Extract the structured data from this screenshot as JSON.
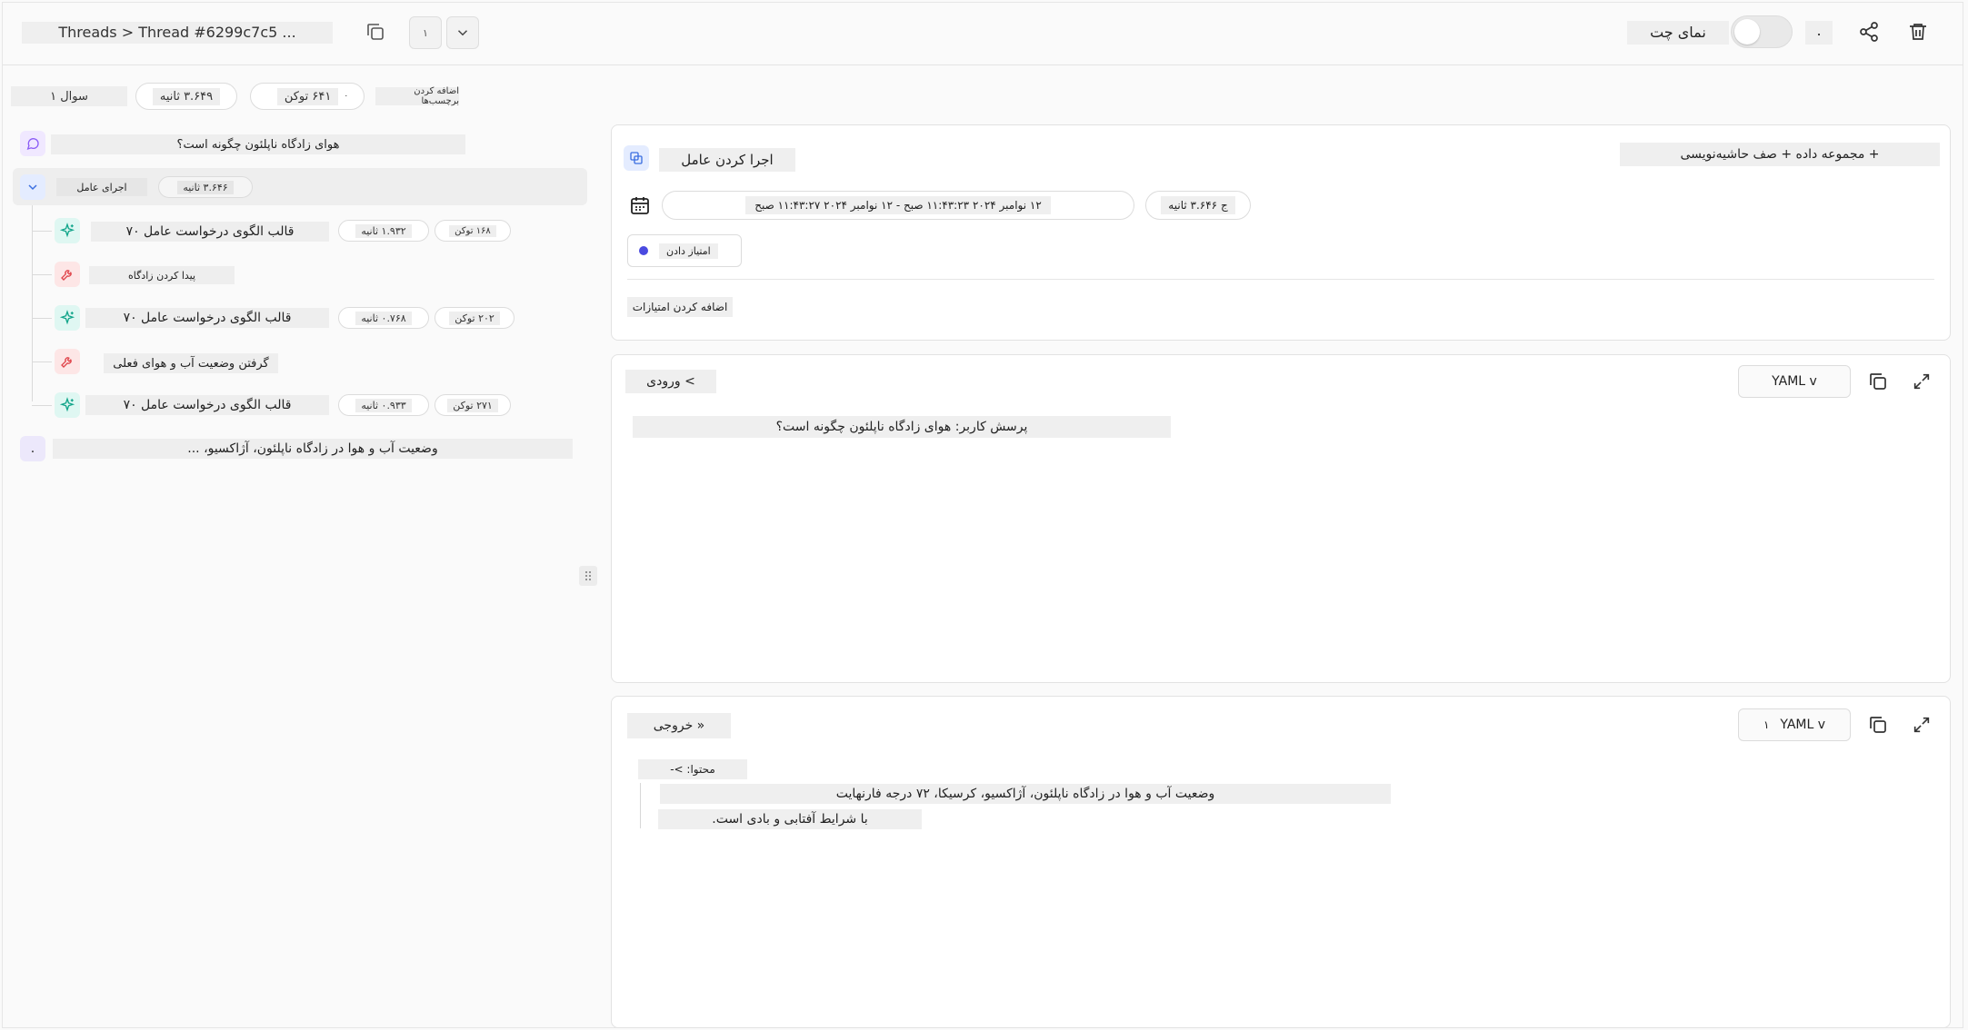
{
  "header": {
    "breadcrumb": "Threads > Thread #6299c7c5 ...",
    "nav_step": "۱",
    "chat_view_label": "نمای چت",
    "dot_label": "."
  },
  "subheader": {
    "question_label": "سوال ۱",
    "duration": "۳.۶۴۹ ثانیه",
    "tokens": "۶۴۱ توکن",
    "tokens_extra": "۰",
    "add_tags": "اضافه کردن برچسب‌ها"
  },
  "tree": {
    "root_question": "هوای زادگاه ناپلئون چگونه است؟",
    "agent_run": {
      "label": "اجرای عامل",
      "duration": "۳.۶۴۶ ثانیه"
    },
    "children": [
      {
        "label": "قالب الگوی درخواست عامل ۷۰",
        "duration": "۱.۹۳۲ ثانیه",
        "tokens": "۱۶۸ توکن",
        "type": "llm"
      },
      {
        "label": "پیدا کردن زادگاه",
        "type": "tool"
      },
      {
        "label": "قالب الگوی درخواست عامل ۷۰",
        "duration": "۰.۷۶۸ ثانیه",
        "tokens": "۲۰۲ توکن",
        "type": "llm"
      },
      {
        "label": "گرفتن وضعیت آب و هوای فعلی",
        "type": "tool"
      },
      {
        "label": "قالب الگوی درخواست عامل ۷۰",
        "duration": "۰.۹۳۳ ثانیه",
        "tokens": "۲۷۱ توکن",
        "type": "llm"
      }
    ],
    "final_answer": "وضعیت آب و هوا در زادگاه ناپلئون، آژاکسیو، ...",
    "final_marker": "."
  },
  "run_panel": {
    "title": "اجرا کردن عامل",
    "add_to_dataset": "+ مجموعه داده + صف حاشیه‌نویسی",
    "time_range": "۱۲ نوامبر ۲۰۲۴ ۱۱:۴۳:۲۳ صبح - ۱۲ نوامبر ۲۰۲۴ ۱۱:۴۳:۲۷ صبح",
    "duration": "ج ۳.۶۴۶ ثانیه",
    "score_label": "امتیاز دادن",
    "add_scores": "اضافه کردن امتیازات"
  },
  "input_panel": {
    "title": "> ورودی",
    "format": "YAML v",
    "content": "پرسش کاربر: هوای زادگاه ناپلئون چگونه است؟"
  },
  "output_panel": {
    "title": "« خروجی",
    "format": "YAML v",
    "format_marker": "۱",
    "content_key": "محتوا: >-",
    "line1": "وضعیت آب و هوا در زادگاه ناپلئون، آژاکسیو، کرسیکا، ۷۲ درجه فارنهایت",
    "line2": "با شرایط آفتابی و بادی است."
  },
  "colors": {
    "llm_icon": "#12a58a",
    "tool_icon": "#e0454b",
    "question_icon": "#8b5cf6",
    "score_dot": "#4a4ae0"
  }
}
